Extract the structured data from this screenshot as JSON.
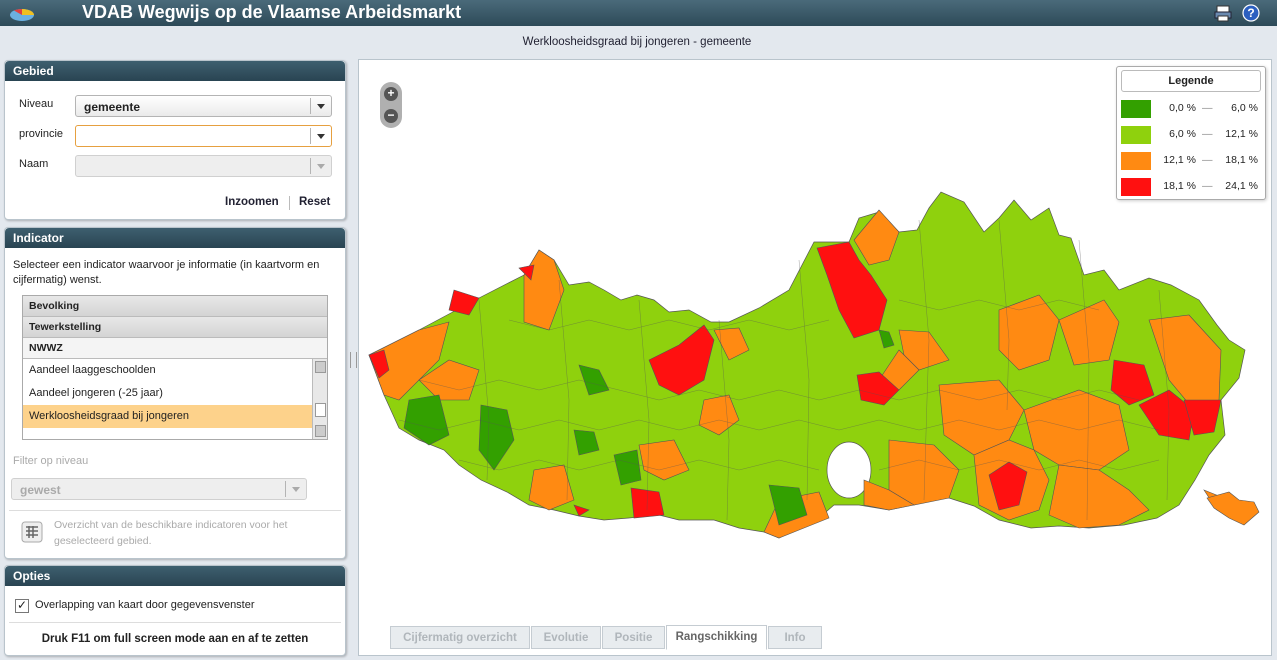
{
  "app": {
    "title": "VDAB Wegwijs op de Vlaamse Arbeidsmarkt"
  },
  "map_title": "Werkloosheidsgraad bij jongeren - gemeente",
  "gebied": {
    "title": "Gebied",
    "niveau_label": "Niveau",
    "niveau_value": "gemeente",
    "provincie_label": "provincie",
    "provincie_value": "",
    "naam_label": "Naam",
    "naam_value": "",
    "zoom_button": "Inzoomen",
    "reset_button": "Reset"
  },
  "indicator": {
    "title": "Indicator",
    "description": "Selecteer een indicator waarvoor je informatie (in kaartvorm en cijfermatig) wenst.",
    "groups": [
      "Bevolking",
      "Tewerkstelling",
      "NWWZ"
    ],
    "items": [
      "Aandeel laaggeschoolden",
      "Aandeel jongeren (-25 jaar)",
      "Werkloosheidsgraad bij jongeren"
    ],
    "selected_item": "Werkloosheidsgraad bij jongeren",
    "filter_label": "Filter op niveau",
    "filter_value": "gewest",
    "overview_text": "Overzicht van de beschikbare indicatoren voor het geselecteerd gebied."
  },
  "opties": {
    "title": "Opties",
    "overlap_label": "Overlapping van kaart door gegevensvenster",
    "overlap_checked": true,
    "fullscreen_hint": "Druk F11 om full screen mode aan en af te zetten"
  },
  "legend": {
    "title": "Legende",
    "classes": [
      {
        "from": "0,0 %",
        "to": "6,0 %",
        "color": "#33a000"
      },
      {
        "from": "6,0 %",
        "to": "12,1 %",
        "color": "#8fd10d"
      },
      {
        "from": "12,1 %",
        "to": "18,1 %",
        "color": "#ff8a12"
      },
      {
        "from": "18,1 %",
        "to": "24,1 %",
        "color": "#ff1010"
      }
    ]
  },
  "zoom": {
    "in": "+",
    "out": "−"
  },
  "tabs": [
    "Cijfermatig overzicht",
    "Evolutie",
    "Positie",
    "Rangschikking",
    "Info"
  ],
  "active_tab": "Rangschikking",
  "colors": {
    "header": "#2d4a58",
    "panel_header": "#3e5f6f",
    "selected_row": "#fdd28b"
  }
}
